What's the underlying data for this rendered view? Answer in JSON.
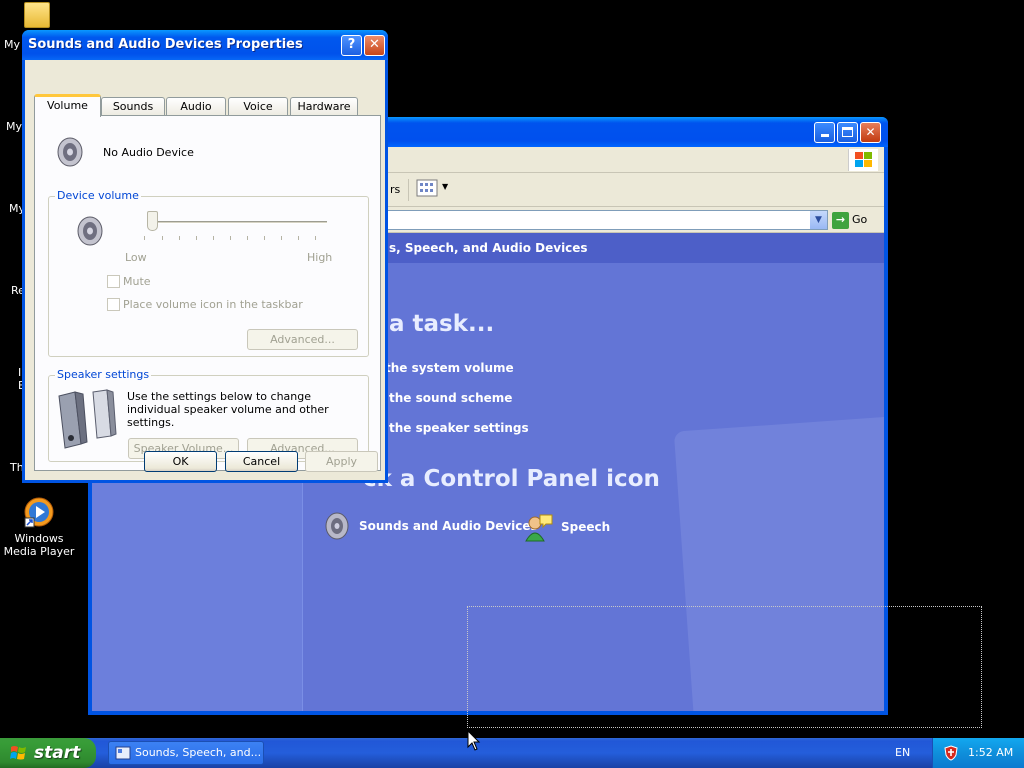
{
  "desktop": {
    "icons": [
      {
        "label": "My D"
      },
      {
        "label": "My"
      },
      {
        "label": "My"
      },
      {
        "label": "Re"
      },
      {
        "label": "I"
      },
      {
        "label": "E"
      },
      {
        "label": "Th"
      },
      {
        "label": "Windows Media Player"
      }
    ]
  },
  "control_panel": {
    "toolbar_partial": "rs",
    "go_label": "Go",
    "header_title": "s, Speech, and Audio Devices",
    "task_heading": "a task...",
    "tasks": [
      {
        "label": "the system volume"
      },
      {
        "label": "the sound scheme"
      },
      {
        "label": "the speaker settings"
      }
    ],
    "icon_heading": "ck a Control Panel icon",
    "icons": [
      {
        "label": "Sounds and Audio Devices"
      },
      {
        "label": "Speech"
      }
    ]
  },
  "dialog": {
    "title": "Sounds and Audio Devices Properties",
    "help_glyph": "?",
    "close_glyph": "✕",
    "tabs": [
      {
        "label": "Volume"
      },
      {
        "label": "Sounds"
      },
      {
        "label": "Audio"
      },
      {
        "label": "Voice"
      },
      {
        "label": "Hardware"
      }
    ],
    "device_name": "No Audio Device",
    "device_volume_label": "Device volume",
    "slider_low": "Low",
    "slider_high": "High",
    "slider_level": 0,
    "mute_label": "Mute",
    "place_icon_label": "Place volume icon in the taskbar",
    "advanced_label": "Advanced...",
    "speaker_settings_label": "Speaker settings",
    "speaker_desc": "Use the settings below to change individual speaker volume and other settings.",
    "speaker_volume_label": "Speaker Volume...",
    "speaker_advanced_label": "Advanced...",
    "ok_label": "OK",
    "cancel_label": "Cancel",
    "apply_label": "Apply"
  },
  "taskbar": {
    "start_label": "start",
    "task_item": "Sounds, Speech, and...",
    "language": "EN",
    "clock": "1:52 AM"
  },
  "colors": {
    "xp_blue": "#0054e3",
    "panel_blue": "#6375d6",
    "start_green": "#379c37",
    "dialog_face": "#ece9d8"
  }
}
